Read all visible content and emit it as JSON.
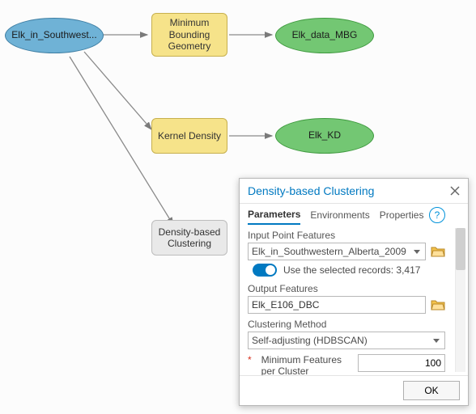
{
  "nodes": {
    "input": "Elk_in_Southwest...",
    "mbg_tool": "Minimum Bounding Geometry",
    "mbg_out": "Elk_data_MBG",
    "kd_tool": "Kernel Density",
    "kd_out": "Elk_KD",
    "dbc_tool": "Density-based Clustering"
  },
  "dlg": {
    "title": "Density-based Clustering",
    "tabs": {
      "parameters": "Parameters",
      "environments": "Environments",
      "properties": "Properties"
    },
    "input_pts_lbl": "Input Point Features",
    "input_pts_val": "Elk_in_Southwestern_Alberta_2009",
    "use_selected": "Use the selected records: 3,417",
    "output_lbl": "Output Features",
    "output_val": "Elk_E106_DBC",
    "method_lbl": "Clustering Method",
    "method_val": "Self-adjusting (HDBSCAN)",
    "min_lbl": "Minimum Features per Cluster",
    "min_val": "100",
    "ok": "OK"
  }
}
